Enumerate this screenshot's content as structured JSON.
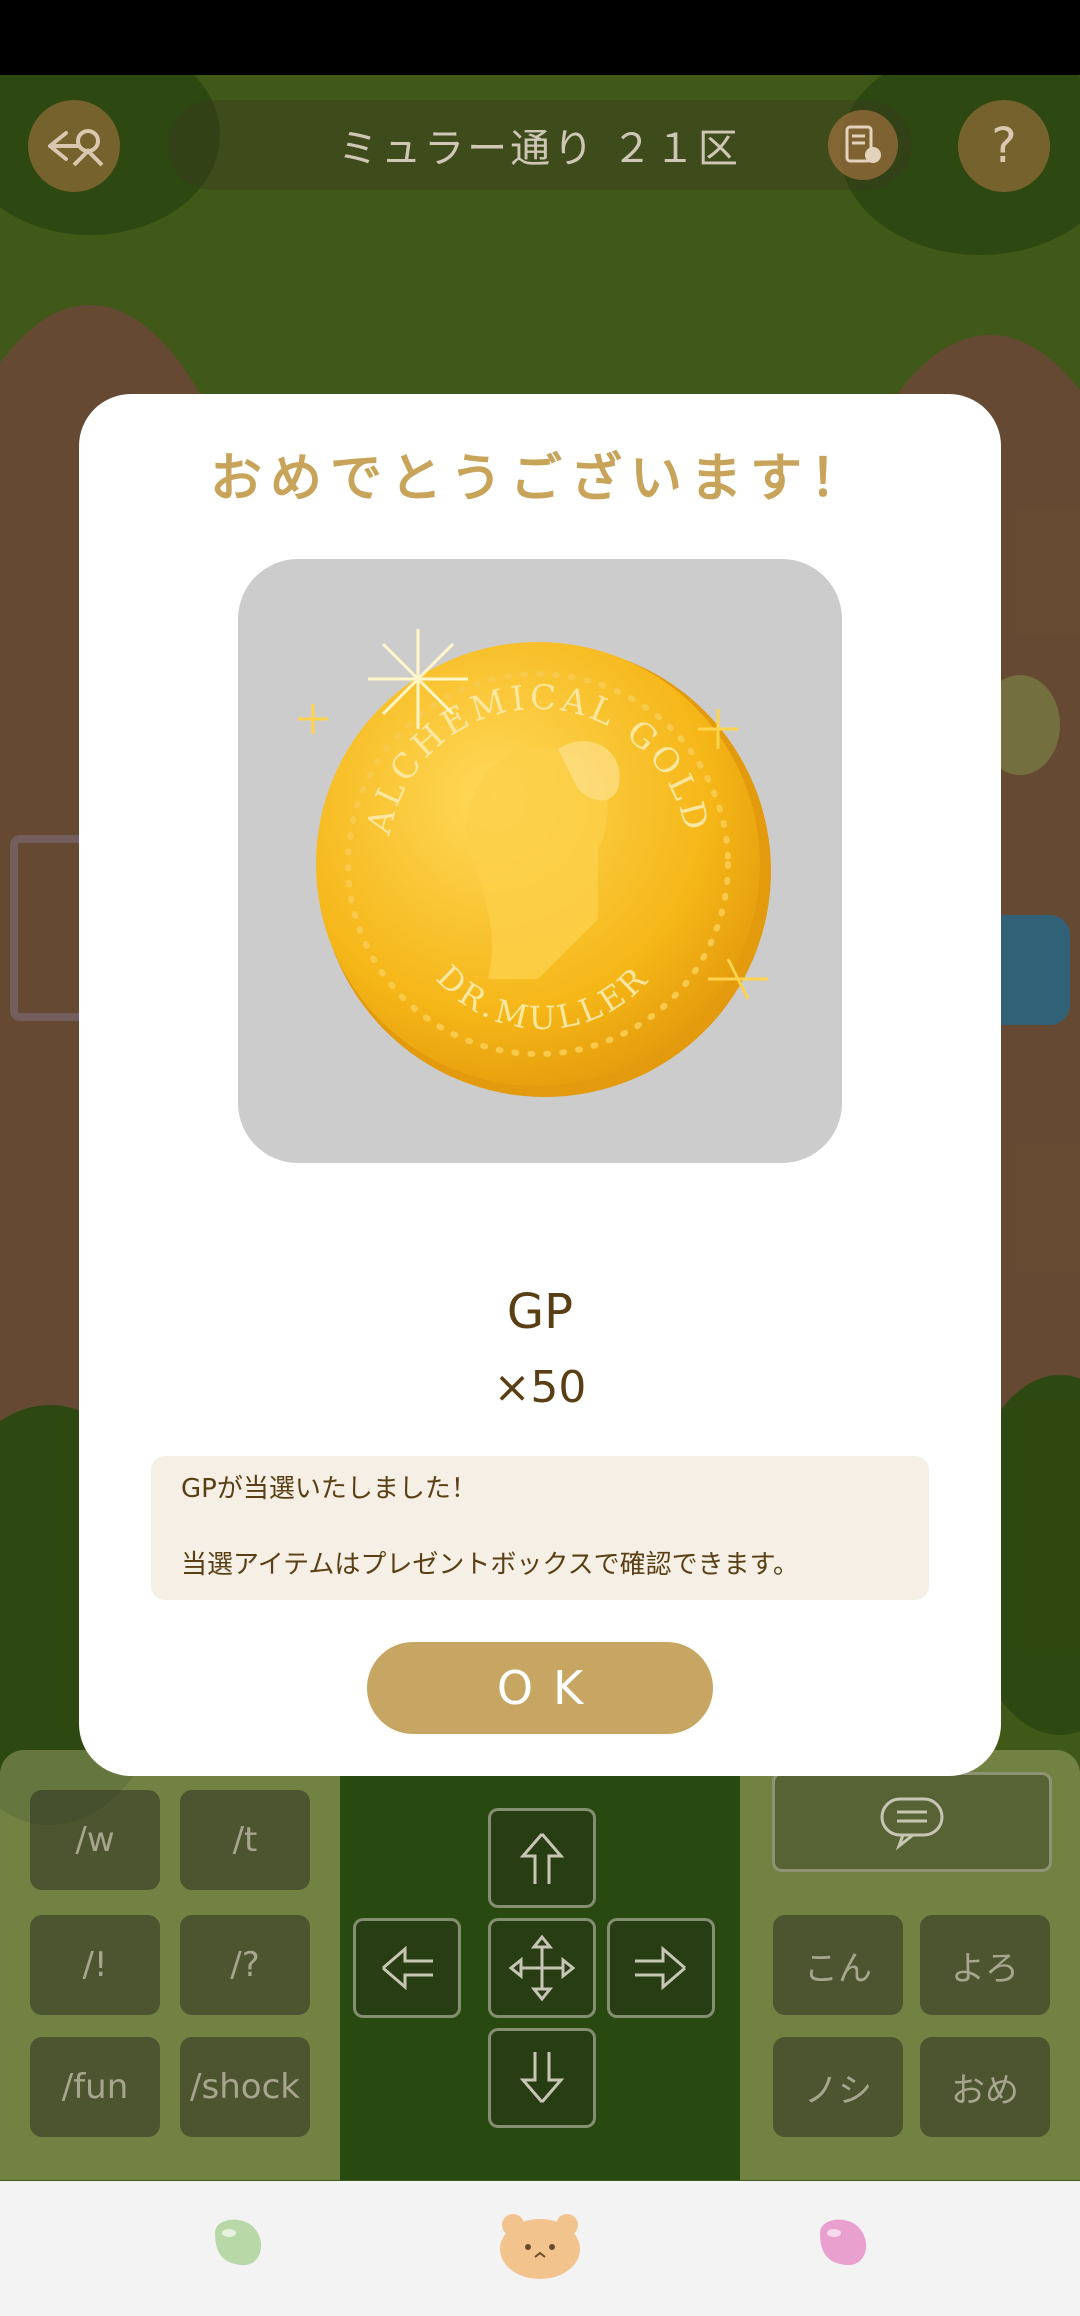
{
  "game": {
    "location": "ミュラー通り ２１区",
    "back_icon": "exit-arrow-icon",
    "map_icon": "map-pin-icon",
    "help_label": "?"
  },
  "controls": {
    "left_keys": [
      "/w",
      "/t",
      "/!",
      "/?",
      "/fun",
      "/shock"
    ],
    "right_keys": [
      "こん",
      "よろ",
      "ノシ",
      "おめ"
    ],
    "chat_icon": "chat-bubble-icon",
    "arrow_icons": [
      "arrow-up-icon",
      "arrow-left-icon",
      "move-icon",
      "arrow-right-icon",
      "arrow-down-icon"
    ]
  },
  "bottom_nav": {
    "items": [
      {
        "icon": "green-bean-icon",
        "color": "#b8d8a8"
      },
      {
        "icon": "bear-face-icon",
        "color": "#f3c38e"
      },
      {
        "icon": "pink-bean-icon",
        "color": "#e9a0cf"
      }
    ]
  },
  "modal": {
    "title": "おめでとうございます！",
    "prize_image": {
      "type": "gold-coin",
      "top_text": "ALCHEMICAL GOLD",
      "bottom_text": "DR.MULLER"
    },
    "prize_name": "GP",
    "prize_qty": "×50",
    "message_lines": [
      "GPが当選いたしました！",
      "",
      "当選アイテムはプレゼントボックスで確認できます。"
    ],
    "ok_label": "OK"
  },
  "colors": {
    "title": "#c8a45a",
    "button": "#c7a664",
    "text": "#5a3f14",
    "message_bg": "#f5efe5"
  }
}
